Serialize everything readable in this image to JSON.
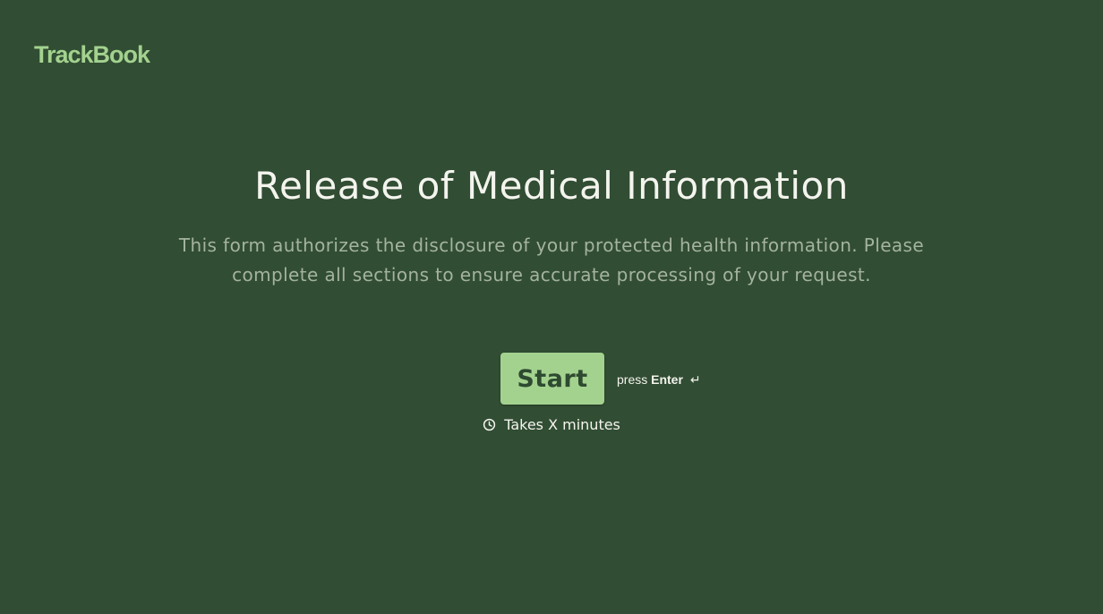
{
  "brand": {
    "logo_text": "TrackBook",
    "logo_color": "#a3d28f"
  },
  "welcome": {
    "title": "Release of Medical Information",
    "description": "This form authorizes the disclosure of your protected health information. Please complete all sections to ensure accurate processing of your request."
  },
  "actions": {
    "start_label": "Start",
    "press_label": "press",
    "key_label": "Enter",
    "enter_icon": "↵"
  },
  "meta": {
    "duration_label": "Takes X minutes",
    "duration_icon": "clock-icon"
  },
  "colors": {
    "background": "#314d33",
    "accent": "#a3d28f",
    "title_text": "#f4f4ee",
    "description_text": "#a4b39f"
  }
}
